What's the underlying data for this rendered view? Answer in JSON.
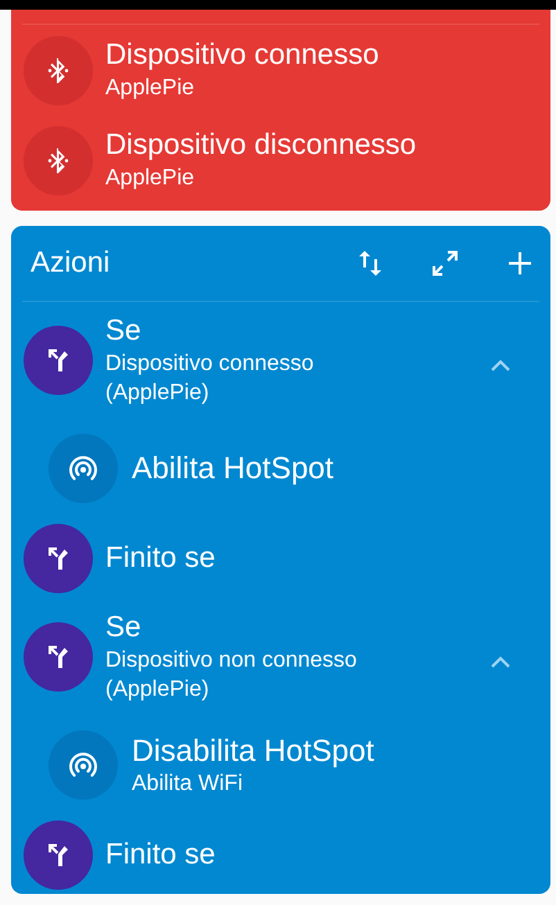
{
  "triggers": [
    {
      "title": "Dispositivo connesso",
      "subtitle": "ApplePie"
    },
    {
      "title": "Dispositivo disconnesso",
      "subtitle": "ApplePie"
    }
  ],
  "actions_panel": {
    "title": "Azioni",
    "items": [
      {
        "kind": "if",
        "title": "Se",
        "subtitle": "Dispositivo connesso (ApplePie)",
        "expanded": true,
        "children": [
          {
            "kind": "hotspot",
            "title": "Abilita HotSpot"
          }
        ]
      },
      {
        "kind": "end_if",
        "title": "Finito se"
      },
      {
        "kind": "if",
        "title": "Se",
        "subtitle": "Dispositivo non connesso (ApplePie)",
        "expanded": true,
        "children": [
          {
            "kind": "hotspot",
            "title": "Disabilita HotSpot",
            "subtitle": "Abilita WiFi"
          }
        ]
      },
      {
        "kind": "end_if",
        "title": "Finito se"
      }
    ]
  }
}
